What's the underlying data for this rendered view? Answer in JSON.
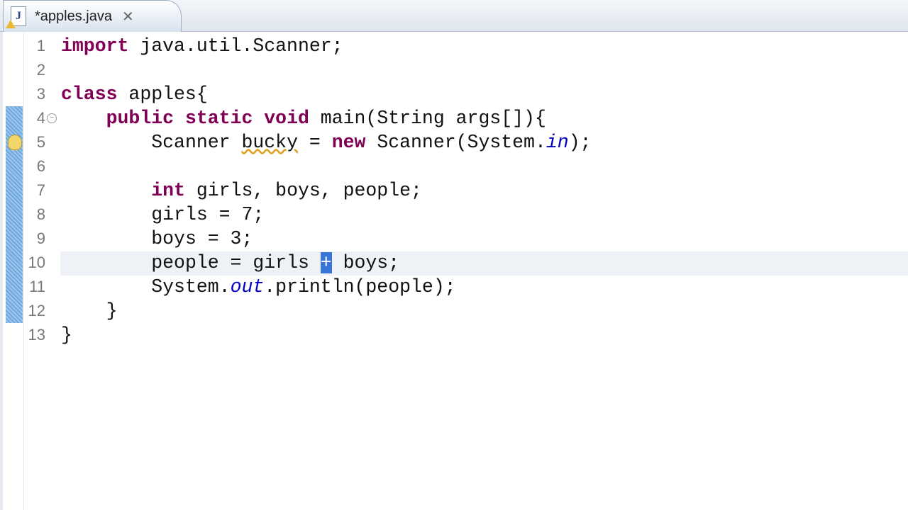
{
  "tab": {
    "label": "*apples.java",
    "icon": "java-file-icon",
    "close": "close-icon"
  },
  "lines": [
    {
      "n": "1",
      "text": "import java.util.Scanner;"
    },
    {
      "n": "2",
      "text": ""
    },
    {
      "n": "3",
      "text": "class apples{"
    },
    {
      "n": "4",
      "text": "    public static void main(String args[]){"
    },
    {
      "n": "5",
      "text": "        Scanner bucky = new Scanner(System.in);"
    },
    {
      "n": "6",
      "text": ""
    },
    {
      "n": "7",
      "text": "        int girls, boys, people;"
    },
    {
      "n": "8",
      "text": "        girls = 7;"
    },
    {
      "n": "9",
      "text": "        boys = 3;"
    },
    {
      "n": "10",
      "text": "        people = girls + boys;"
    },
    {
      "n": "11",
      "text": "        System.out.println(people);"
    },
    {
      "n": "12",
      "text": "    }"
    },
    {
      "n": "13",
      "text": "}"
    }
  ],
  "tokens": {
    "import": "import",
    "rest1": " java.util.Scanner;",
    "class": "class",
    "rest3": " apples{",
    "public": "public",
    "static": "static",
    "void": "void",
    "rest4": " main(String args[]){",
    "l5a": "Scanner ",
    "bucky": "bucky",
    "l5b": " = ",
    "new": "new",
    "l5c": " Scanner(System.",
    "in": "in",
    "l5d": ");",
    "int": "int",
    "rest7": " girls, boys, people;",
    "l8": "girls = 7;",
    "l9": "boys = 3;",
    "l10a": "people = girls ",
    "l10sel": "+",
    "l10b": " boys;",
    "l11a": "System.",
    "out": "out",
    "l11b": ".println(people);",
    "l12": "}",
    "l13": "}"
  }
}
